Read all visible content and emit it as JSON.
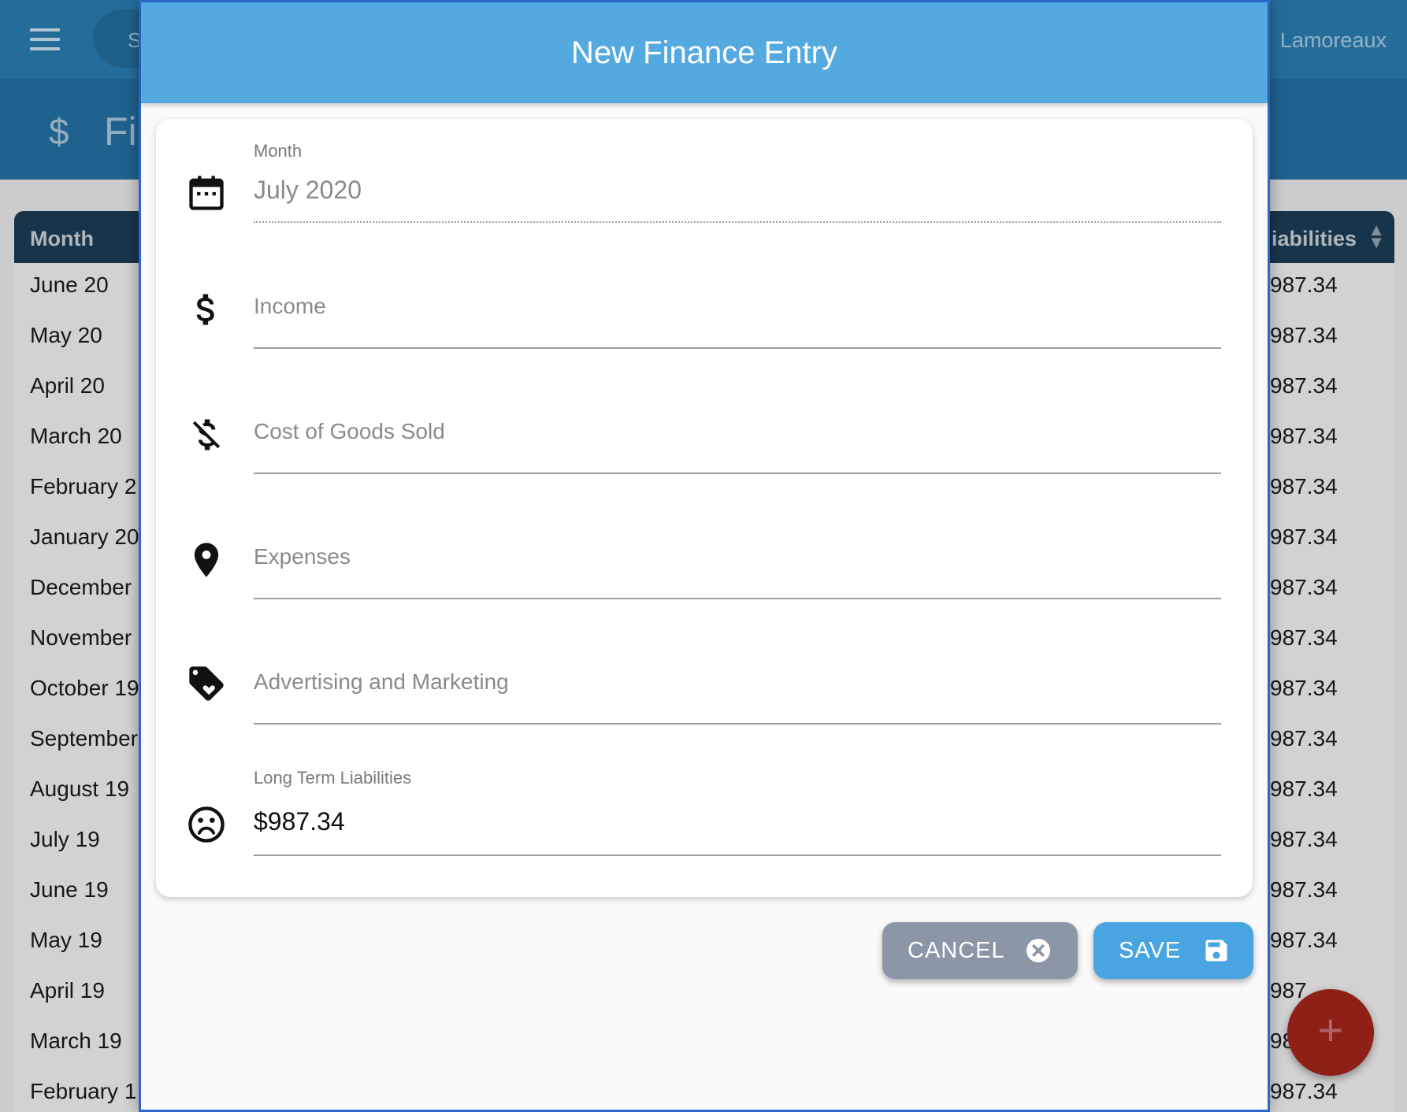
{
  "app": {
    "search_placeholder": "S",
    "user_name": "Lamoreaux",
    "page_icon_glyph": "$",
    "page_title_visible": "Fi"
  },
  "table": {
    "col_month": "Month",
    "col_liabilities": "iabilities",
    "rows": [
      {
        "month": "June 20",
        "liab": "987.34"
      },
      {
        "month": "May 20",
        "liab": "987.34"
      },
      {
        "month": "April 20",
        "liab": "987.34"
      },
      {
        "month": "March 20",
        "liab": "987.34"
      },
      {
        "month": "February 2",
        "liab": "987.34"
      },
      {
        "month": "January 20",
        "liab": "987.34"
      },
      {
        "month": "December",
        "liab": "987.34"
      },
      {
        "month": "November",
        "liab": "987.34"
      },
      {
        "month": "October 19",
        "liab": "987.34"
      },
      {
        "month": "September",
        "liab": "987.34"
      },
      {
        "month": "August 19",
        "liab": "987.34"
      },
      {
        "month": "July 19",
        "liab": "987.34"
      },
      {
        "month": "June 19",
        "liab": "987.34"
      },
      {
        "month": "May 19",
        "liab": "987.34"
      },
      {
        "month": "April 19",
        "liab": "987"
      },
      {
        "month": "March 19",
        "liab": "98"
      },
      {
        "month": "February 1",
        "liab": "987.34"
      }
    ]
  },
  "fab": {
    "glyph": "+"
  },
  "dialog": {
    "title": "New Finance Entry",
    "fields": {
      "month": {
        "label": "Month",
        "value": "July 2020",
        "icon": "calendar-icon"
      },
      "income": {
        "placeholder": "Income",
        "icon": "dollar-icon"
      },
      "cogs": {
        "placeholder": "Cost of Goods Sold",
        "icon": "money-off-icon"
      },
      "expenses": {
        "placeholder": "Expenses",
        "icon": "location-pin-icon"
      },
      "advertising": {
        "placeholder": "Advertising and Marketing",
        "icon": "tag-heart-icon"
      },
      "liabilities": {
        "label": "Long Term Liabilities",
        "value": "$987.34",
        "icon": "sad-face-icon"
      }
    },
    "cancel_label": "CANCEL",
    "save_label": "SAVE"
  },
  "colors": {
    "appbar": "#2a7db0",
    "dialog_header": "#55a9e1",
    "cancel_button": "#8b96a6",
    "save_button": "#49a5e2",
    "fab": "#a3251c"
  }
}
